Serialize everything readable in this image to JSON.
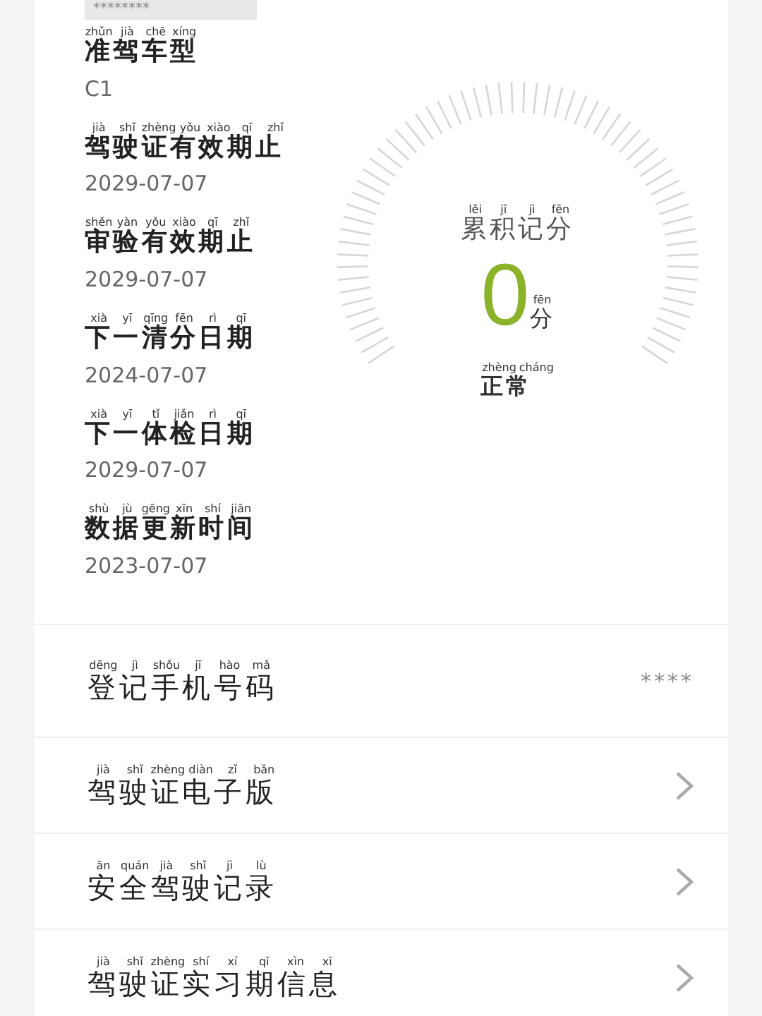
{
  "masked_header": "********",
  "fields": [
    {
      "label": "准驾车型",
      "pinyin": [
        "zhǔn",
        "jià",
        "chē",
        "xíng"
      ],
      "value": "C1"
    },
    {
      "label": "驾驶证有效期止",
      "pinyin": [
        "jià",
        "shǐ",
        "zhèng",
        "yǒu",
        "xiào",
        "qī",
        "zhǐ"
      ],
      "value": "2029-07-07"
    },
    {
      "label": "审验有效期止",
      "pinyin": [
        "shěn",
        "yàn",
        "yǒu",
        "xiào",
        "qī",
        "zhǐ"
      ],
      "value": "2029-07-07"
    },
    {
      "label": "下一清分日期",
      "pinyin": [
        "xià",
        "yī",
        "qīng",
        "fēn",
        "rì",
        "qī"
      ],
      "value": "2024-07-07"
    },
    {
      "label": "下一体检日期",
      "pinyin": [
        "xià",
        "yī",
        "tǐ",
        "jiǎn",
        "rì",
        "qī"
      ],
      "value": "2029-07-07"
    },
    {
      "label": "数据更新时间",
      "pinyin": [
        "shù",
        "jù",
        "gēng",
        "xīn",
        "shí",
        "jiān"
      ],
      "value": "2023-07-07"
    }
  ],
  "score": {
    "title": "累积记分",
    "title_pinyin": [
      "lěi",
      "jī",
      "jì",
      "fēn"
    ],
    "value": "0",
    "unit": "分",
    "unit_pinyin": [
      "fēn"
    ],
    "status": "正常",
    "status_pinyin": [
      "zhèng",
      "cháng"
    ]
  },
  "rows": [
    {
      "kind": "value",
      "label": "登记手机号码",
      "pinyin": [
        "dēng",
        "jì",
        "shǒu",
        "jī",
        "hào",
        "mǎ"
      ],
      "value": "****"
    },
    {
      "kind": "link",
      "label": "驾驶证电子版",
      "pinyin": [
        "jià",
        "shǐ",
        "zhèng",
        "diàn",
        "zǐ",
        "bǎn"
      ]
    },
    {
      "kind": "link",
      "label": "安全驾驶记录",
      "pinyin": [
        "ān",
        "quán",
        "jià",
        "shǐ",
        "jì",
        "lù"
      ]
    },
    {
      "kind": "link",
      "label": "驾驶证实习期信息",
      "pinyin": [
        "jià",
        "shǐ",
        "zhèng",
        "shí",
        "xí",
        "qī",
        "xìn",
        "xī"
      ]
    }
  ]
}
